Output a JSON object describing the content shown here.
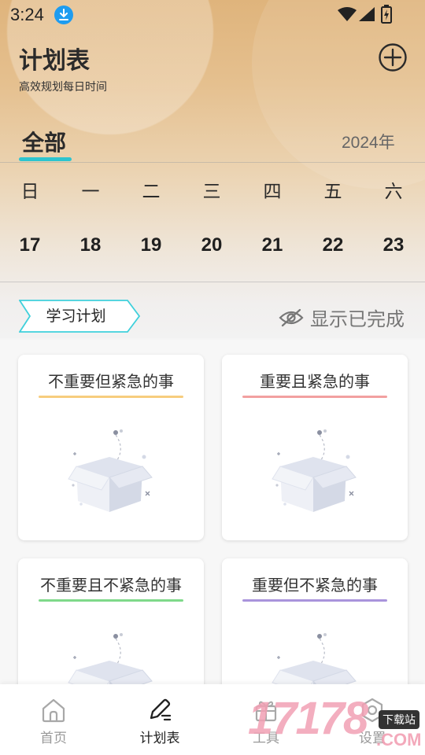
{
  "status_bar": {
    "time": "3:24"
  },
  "header": {
    "title": "计划表",
    "subtitle": "高效规划每日时间"
  },
  "tabs": {
    "active_label": "全部"
  },
  "year_label": "2024年",
  "calendar": {
    "weekdays": [
      "日",
      "一",
      "二",
      "三",
      "四",
      "五",
      "六"
    ],
    "dates": [
      "17",
      "18",
      "19",
      "20",
      "21",
      "22",
      "23"
    ]
  },
  "plan_selector": {
    "label": "学习计划"
  },
  "show_completed": {
    "label": "显示已完成"
  },
  "quadrants": [
    {
      "title": "不重要但紧急的事",
      "accent": "#f7cd7e"
    },
    {
      "title": "重要且紧急的事",
      "accent": "#f2a0a0"
    },
    {
      "title": "不重要且不紧急的事",
      "accent": "#7fd98a"
    },
    {
      "title": "重要但不紧急的事",
      "accent": "#a994dc"
    }
  ],
  "bottom_nav": [
    {
      "label": "首页",
      "icon": "home-icon",
      "active": false
    },
    {
      "label": "计划表",
      "icon": "edit-icon",
      "active": true
    },
    {
      "label": "工具",
      "icon": "gift-icon",
      "active": false
    },
    {
      "label": "设置",
      "icon": "settings-icon",
      "active": false
    }
  ],
  "watermark": {
    "text": "17178",
    "badge": "下载站",
    "suffix": ".COM"
  },
  "colors": {
    "tab_accent": "#2ec4cf",
    "plan_tag_border": "#3fd0db"
  }
}
